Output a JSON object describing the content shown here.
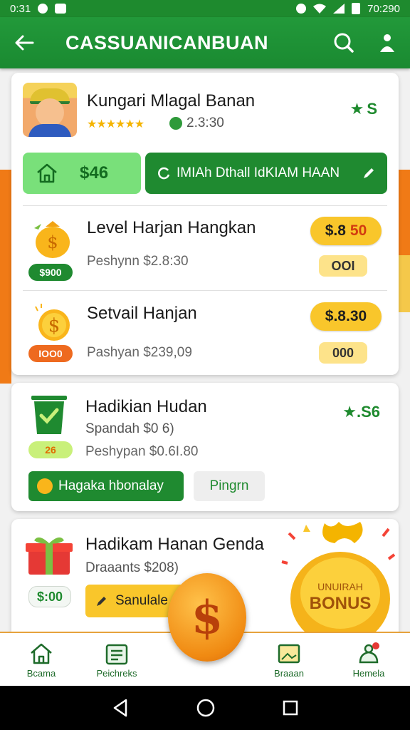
{
  "status_bar": {
    "time_left": "0:31",
    "time_right": "70:290"
  },
  "app_bar": {
    "title": "CASSUANICANBUAN"
  },
  "profile": {
    "name": "Kungari Mlagal Banan",
    "stars": "★★★★★★",
    "coins": "2.3:30",
    "rating": "S"
  },
  "actions": {
    "home_value": "$46",
    "wide_label": "IMIAh Dthall IdKIAM HAAN"
  },
  "rewards": [
    {
      "title": "Level Harjan Hangkan",
      "chip": "$900",
      "subtitle": "Peshynn $2.8:30",
      "price": "$.8",
      "price_suffix": "50",
      "count": "OOI"
    },
    {
      "title": "Setvail Hanjan",
      "chip": "IOO0",
      "subtitle": "Pashyan $239,09",
      "price": "$.8.30",
      "price_suffix": "",
      "count": "000"
    }
  ],
  "task": {
    "title": "Hadikian Hudan",
    "subtitle": "Spandah $0 6)",
    "chip": "26",
    "subtitle2": "Peshypan $0.6I.80",
    "rating": "★.S6",
    "claim_label": "Hagaka hbonalay",
    "secondary_label": "Pingrn"
  },
  "bonus": {
    "title": "Hadikam Hanan Genda",
    "subtitle": "Draaants $208)",
    "chip": "$:00",
    "button_label": "Sanulale",
    "bag_text_top": "UNUIRAH",
    "bag_text_main": "BONUS"
  },
  "bottom_nav": [
    {
      "label": "Bcama"
    },
    {
      "label": "Peichreks"
    },
    {
      "label": "Braaan"
    },
    {
      "label": "Hemela"
    }
  ],
  "colors": {
    "primary": "#1f8a30",
    "accent": "#f9c62b",
    "orange": "#ee6a1f"
  }
}
